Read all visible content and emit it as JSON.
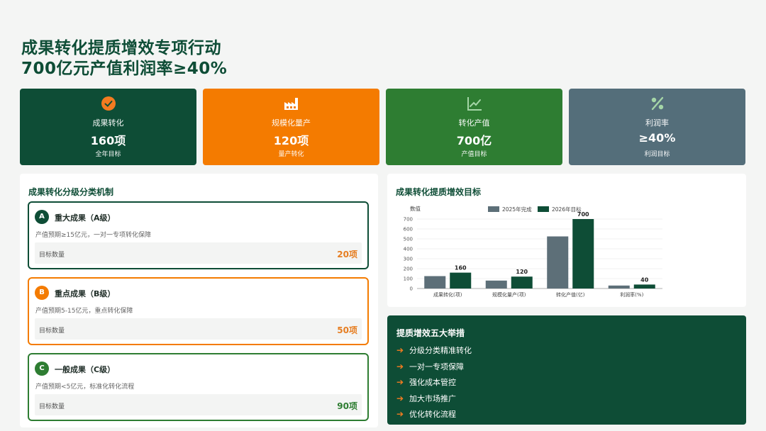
{
  "header": {
    "line1": "成果转化提质增效专项行动",
    "line2": "700亿元产值利润率≥40%"
  },
  "kpis": [
    {
      "icon": "check-circle-icon",
      "label": "成果转化",
      "value": "160项",
      "sub": "全年目标",
      "color": "#0e4d36"
    },
    {
      "icon": "factory-icon",
      "label": "规模化量产",
      "value": "120项",
      "sub": "量产转化",
      "color": "#f47b00"
    },
    {
      "icon": "line-chart-icon",
      "label": "转化产值",
      "value": "700亿",
      "sub": "产值目标",
      "color": "#2e7d32"
    },
    {
      "icon": "percent-icon",
      "label": "利润率",
      "value": "≥40%",
      "sub": "利润目标",
      "color": "#546e7a"
    }
  ],
  "tiers_panel": {
    "title": "成果转化分级分类机制",
    "tiers": [
      {
        "badge": "A",
        "name": "重大成果（A级）",
        "desc": "产值预期≥15亿元，一对一专项转化保障",
        "label": "目标数量",
        "value": "20项",
        "color": "#0e4d36",
        "value_color": "#e67e22"
      },
      {
        "badge": "B",
        "name": "重点成果（B级）",
        "desc": "产值预期5-15亿元，重点转化保障",
        "label": "目标数量",
        "value": "50项",
        "color": "#f47b00",
        "value_color": "#e67e22"
      },
      {
        "badge": "C",
        "name": "一般成果（C级）",
        "desc": "产值预期<5亿元，标准化转化流程",
        "label": "目标数量",
        "value": "90项",
        "color": "#2e7d32",
        "value_color": "#2e7d32"
      }
    ]
  },
  "chart_panel": {
    "title": "成果转化提质增效目标"
  },
  "chart_data": {
    "type": "bar",
    "ylabel": "数值",
    "categories": [
      "成果转化(项)",
      "规模化量产(项)",
      "转化产值(亿)",
      "利润率(%)"
    ],
    "series": [
      {
        "name": "2025年完成",
        "values": [
          125,
          80,
          525,
          30
        ],
        "color": "#5d6f78"
      },
      {
        "name": "2026年目标",
        "values": [
          160,
          120,
          700,
          40
        ],
        "color": "#0e4d36"
      }
    ],
    "data_labels": [
      "160",
      "120",
      "700",
      "40"
    ],
    "yticks": [
      0,
      100,
      200,
      300,
      400,
      500,
      600,
      700
    ],
    "ylim": [
      0,
      700
    ],
    "legend_position": "top"
  },
  "measures": {
    "title": "提质增效五大举措",
    "items": [
      "分级分类精准转化",
      "一对一专项保障",
      "强化成本管控",
      "加大市场推广",
      "优化转化流程"
    ],
    "arrow": "➔"
  }
}
